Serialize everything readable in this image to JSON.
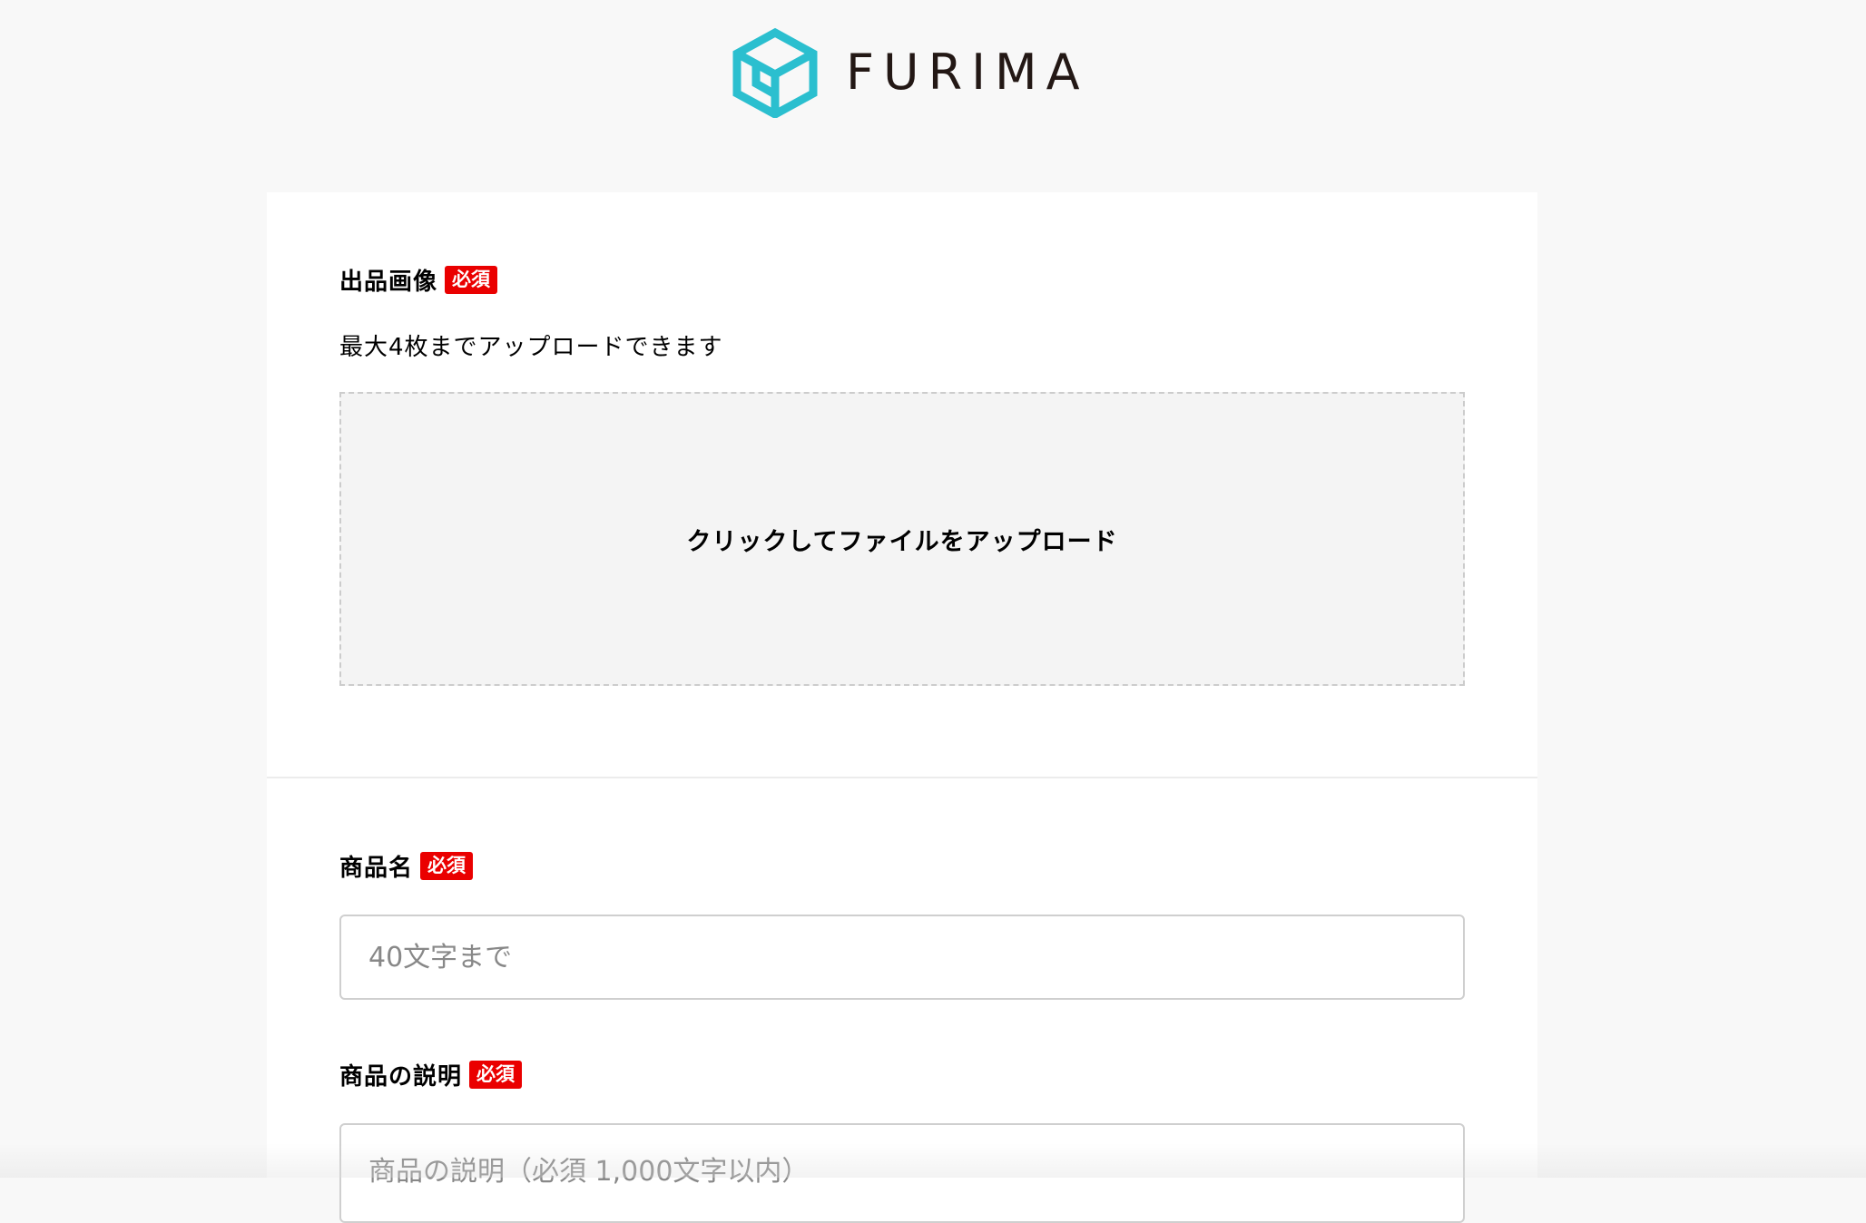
{
  "brand": {
    "name": "FURIMA",
    "accent_color": "#2bbfcf",
    "logo_icon": "cube-icon"
  },
  "required_badge": "必須",
  "image_section": {
    "label": "出品画像",
    "note": "最大4枚までアップロードできます",
    "dropzone_text": "クリックしてファイルをアップロード"
  },
  "product_name": {
    "label": "商品名",
    "placeholder": "40文字まで",
    "value": ""
  },
  "product_description": {
    "label": "商品の説明",
    "placeholder": "商品の説明（必須 1,000文字以内）",
    "value": ""
  },
  "colors": {
    "badge_red": "#ea0000",
    "page_bg": "#f8f8f8",
    "card_bg": "#ffffff",
    "dropzone_bg": "#f4f4f4"
  }
}
